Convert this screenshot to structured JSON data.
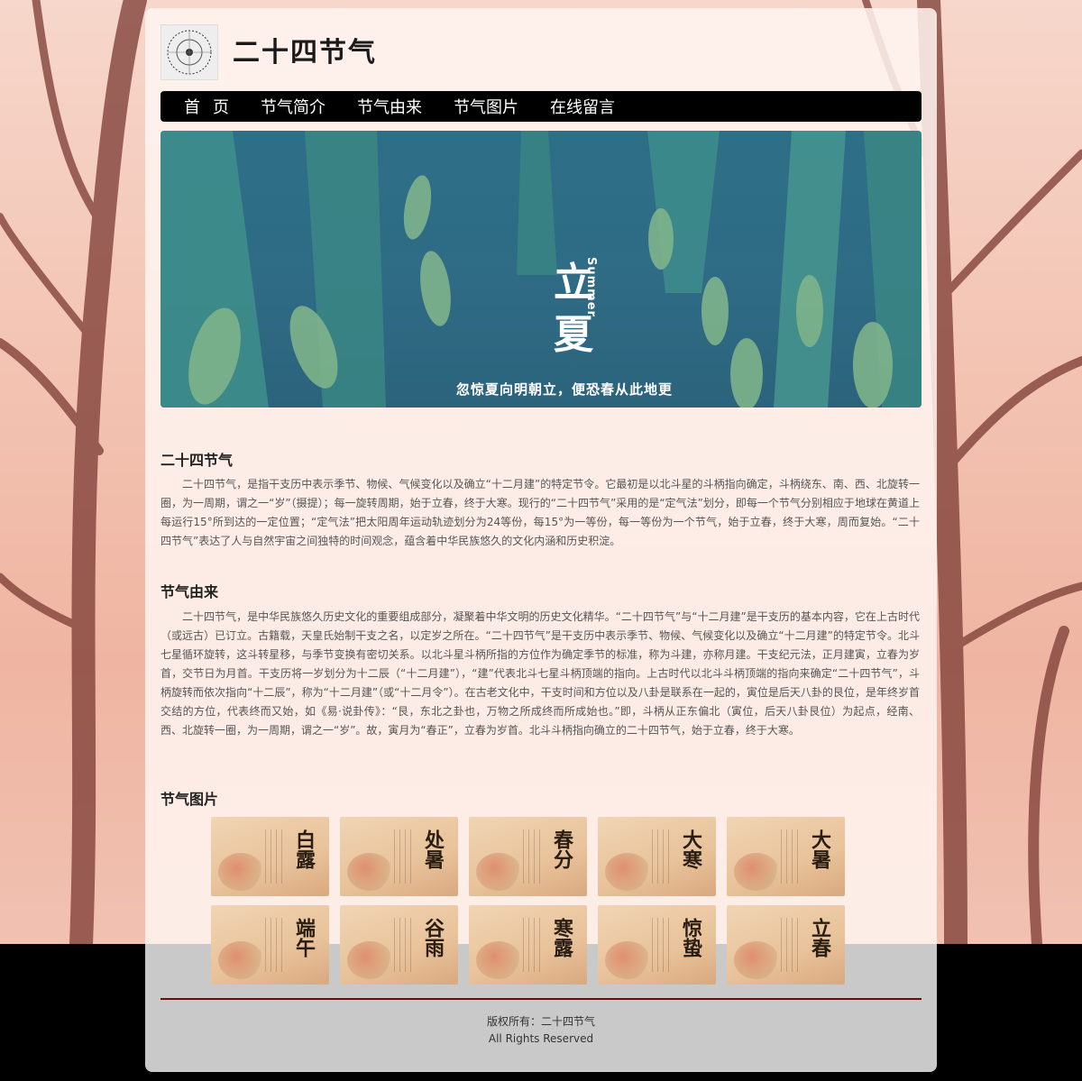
{
  "site": {
    "title": "二十四节气"
  },
  "nav": {
    "items": [
      "首页",
      "节气简介",
      "节气由来",
      "节气图片",
      "在线留言"
    ]
  },
  "banner": {
    "title_line1": "立",
    "title_line2": "夏",
    "english": "Summer",
    "caption": "忽惊夏向明朝立，便恐春从此地更"
  },
  "intro": {
    "heading": "二十四节气",
    "text": "二十四节气，是指干支历中表示季节、物候、气候变化以及确立“十二月建”的特定节令。它最初是以北斗星的斗柄指向确定，斗柄绕东、南、西、北旋转一圈，为一周期，谓之一“岁”（摄提）；每一旋转周期，始于立春，终于大寒。现行的“二十四节气”采用的是“定气法”划分，即每一个节气分别相应于地球在黄道上每运行15°所到达的一定位置；“定气法”把太阳周年运动轨迹划分为24等份，每15°为一等份，每一等份为一个节气，始于立春，终于大寒，周而复始。“二十四节气”表达了人与自然宇宙之间独特的时间观念，蕴含着中华民族悠久的文化内涵和历史积淀。"
  },
  "origin": {
    "heading": "节气由来",
    "text": "二十四节气，是中华民族悠久历史文化的重要组成部分，凝聚着中华文明的历史文化精华。“二十四节气”与“十二月建”是干支历的基本内容，它在上古时代（或远古）已订立。古籍载，天皇氏始制干支之名，以定岁之所在。“二十四节气”是干支历中表示季节、物候、气候变化以及确立“十二月建”的特定节令。北斗七星循环旋转，这斗转星移，与季节变换有密切关系。以北斗星斗柄所指的方位作为确定季节的标准，称为斗建，亦称月建。干支纪元法，正月建寅，立春为岁首，交节日为月首。干支历将一岁划分为十二辰（“十二月建”），“建”代表北斗七星斗柄顶端的指向。上古时代以北斗斗柄顶端的指向来确定“二十四节气”，斗柄旋转而依次指向“十二辰”，称为“十二月建”（或“十二月令”）。在古老文化中，干支时间和方位以及八卦是联系在一起的，寅位是后天八卦的艮位，是年终岁首交结的方位，代表终而又始，如《易·说卦传》：“艮，东北之卦也，万物之所成终而所成始也。”即，斗柄从正东偏北（寅位，后天八卦艮位）为起点，经南、西、北旋转一圈，为一周期，谓之一“岁”。故，寅月为“春正”，立春为岁首。北斗斗柄指向确立的二十四节气，始于立春，终于大寒。"
  },
  "gallery": {
    "heading": "节气图片",
    "items": [
      "白露",
      "处暑",
      "春分",
      "大寒",
      "大暑",
      "端午",
      "谷雨",
      "寒露",
      "惊蛰",
      "立春"
    ]
  },
  "footer": {
    "copyright": "版权所有：二十四节气",
    "rights": "All Rights Reserved"
  },
  "colors": {
    "nav_bg": "#000000",
    "footer_line": "#6b0b0b",
    "banner_bg": "#2d6f86"
  }
}
